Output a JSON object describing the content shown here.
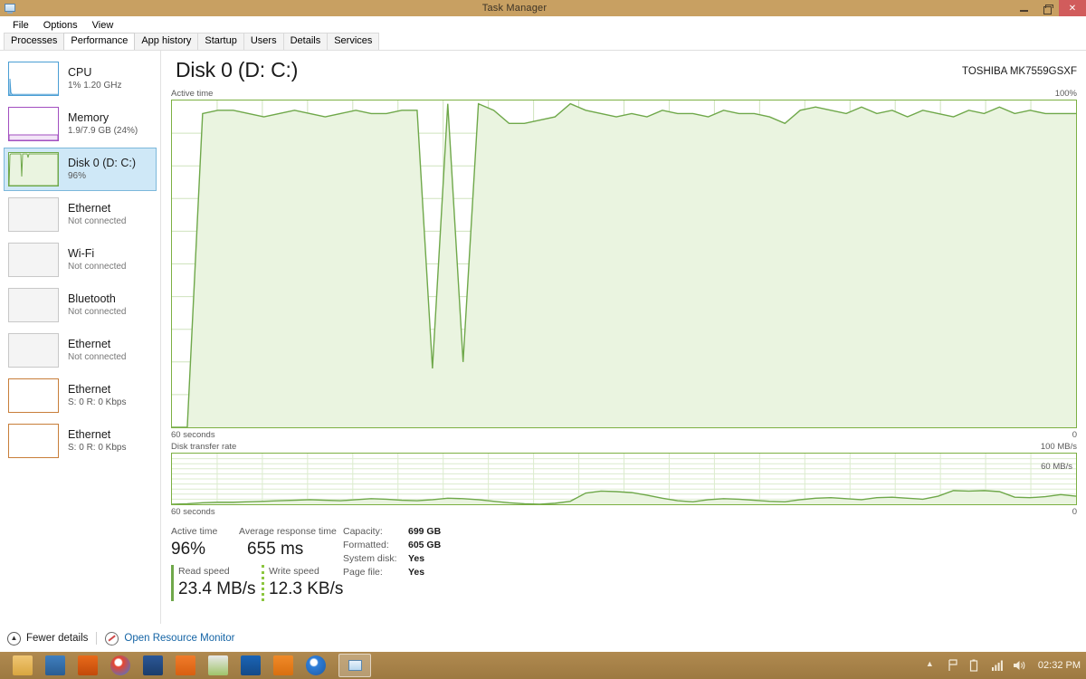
{
  "window": {
    "title": "Task Manager",
    "icon": "task-manager-icon",
    "minimize_label": "Minimize",
    "restore_label": "Restore",
    "close_label": "Close"
  },
  "menu": {
    "items": [
      "File",
      "Options",
      "View"
    ]
  },
  "tabs": {
    "items": [
      "Processes",
      "Performance",
      "App history",
      "Startup",
      "Users",
      "Details",
      "Services"
    ],
    "active": "Performance"
  },
  "sidebar": {
    "items": [
      {
        "title": "CPU",
        "sub": "1%  1.20 GHz",
        "kind": "cpu",
        "selected": false,
        "accent": "#4a9ed4"
      },
      {
        "title": "Memory",
        "sub": "1.9/7.9 GB (24%)",
        "kind": "mem",
        "selected": false,
        "accent": "#a24fc0"
      },
      {
        "title": "Disk 0 (D: C:)",
        "sub": "96%",
        "kind": "disk",
        "selected": true,
        "accent": "#6fa84a"
      },
      {
        "title": "Ethernet",
        "sub": "Not connected",
        "kind": "inactive",
        "selected": false,
        "accent": "#c8c8c8"
      },
      {
        "title": "Wi-Fi",
        "sub": "Not connected",
        "kind": "inactive",
        "selected": false,
        "accent": "#c8c8c8"
      },
      {
        "title": "Bluetooth",
        "sub": "Not connected",
        "kind": "inactive",
        "selected": false,
        "accent": "#c8c8c8"
      },
      {
        "title": "Ethernet",
        "sub": "Not connected",
        "kind": "inactive",
        "selected": false,
        "accent": "#c8c8c8"
      },
      {
        "title": "Ethernet",
        "sub": "S: 0 R: 0 Kbps",
        "kind": "eth-on",
        "selected": false,
        "accent": "#c87e3a"
      },
      {
        "title": "Ethernet",
        "sub": "S: 0 R: 0 Kbps",
        "kind": "eth-on",
        "selected": false,
        "accent": "#c87e3a"
      }
    ]
  },
  "main": {
    "title": "Disk 0 (D: C:)",
    "model": "TOSHIBA MK7559GSXF",
    "active_time_label": "Active time",
    "active_time_max": "100%",
    "active_time_min": "0",
    "time_axis_left": "60 seconds",
    "transfer_label": "Disk transfer rate",
    "transfer_max": "100 MB/s",
    "transfer_mid": "60 MB/s",
    "transfer_min": "0",
    "transfer_time_left": "60 seconds"
  },
  "stats": {
    "active_time_caption": "Active time",
    "active_time_value": "96%",
    "avg_response_caption": "Average response time",
    "avg_response_value": "655 ms",
    "read_speed_caption": "Read speed",
    "read_speed_value": "23.4 MB/s",
    "write_speed_caption": "Write speed",
    "write_speed_value": "12.3 KB/s",
    "details": [
      {
        "key": "Capacity:",
        "value": "699 GB"
      },
      {
        "key": "Formatted:",
        "value": "605 GB"
      },
      {
        "key": "System disk:",
        "value": "Yes"
      },
      {
        "key": "Page file:",
        "value": "Yes"
      }
    ]
  },
  "footer": {
    "fewer_details": "Fewer details",
    "open_resource_monitor": "Open Resource Monitor",
    "chevron_icon": "chevron-up-icon",
    "resource_monitor_icon": "resource-monitor-icon"
  },
  "taskbar": {
    "icons": [
      "file-explorer-icon",
      "contacts-icon",
      "firefox-icon",
      "chrome-icon",
      "word-icon",
      "excel-icon",
      "notepad-icon",
      "outlook-icon",
      "media-player-icon",
      "music-icon"
    ],
    "active_window_icon": "task-manager-icon",
    "tray_icons": [
      "show-hidden-icon",
      "action-center-icon",
      "battery-icon",
      "network-icon",
      "volume-icon"
    ],
    "clock": "02:32 PM"
  },
  "colors": {
    "titlebar": "#c8a062",
    "close_button": "#d15c5c",
    "graph_line": "#6fa84a",
    "graph_fill": "#eaf4e0",
    "grid": "#cfe3bd",
    "selection": "#cfe8f7",
    "link": "#1464a5",
    "taskbar": "#a88049"
  },
  "chart_data": {
    "type": "area",
    "title": "Active time",
    "xlabel": "60 seconds",
    "ylabel": "%",
    "ylim": [
      0,
      100
    ],
    "x": [
      0,
      1,
      2,
      3,
      4,
      5,
      6,
      7,
      8,
      9,
      10,
      11,
      12,
      13,
      14,
      15,
      16,
      17,
      18,
      19,
      20,
      21,
      22,
      23,
      24,
      25,
      26,
      27,
      28,
      29,
      30,
      31,
      32,
      33,
      34,
      35,
      36,
      37,
      38,
      39,
      40,
      41,
      42,
      43,
      44,
      45,
      46,
      47,
      48,
      49,
      50,
      51,
      52,
      53,
      54,
      55,
      56,
      57,
      58,
      59
    ],
    "values": [
      0,
      0,
      96,
      97,
      97,
      96,
      95,
      96,
      97,
      96,
      95,
      96,
      97,
      96,
      96,
      97,
      97,
      18,
      99,
      20,
      99,
      97,
      93,
      93,
      94,
      95,
      99,
      97,
      96,
      95,
      96,
      95,
      97,
      96,
      96,
      95,
      97,
      96,
      96,
      95,
      93,
      97,
      98,
      97,
      96,
      98,
      96,
      97,
      95,
      97,
      96,
      95,
      97,
      96,
      98,
      96,
      97,
      96,
      96,
      96
    ],
    "secondary_chart": {
      "type": "area",
      "title": "Disk transfer rate",
      "xlabel": "60 seconds",
      "ylabel": "MB/s",
      "ylim": [
        0,
        100
      ],
      "gridline_labels": [
        "100 MB/s",
        "60 MB/s",
        "0"
      ],
      "values": [
        0,
        1,
        3,
        4,
        4,
        5,
        6,
        7,
        8,
        9,
        8,
        7,
        9,
        11,
        10,
        8,
        7,
        9,
        12,
        11,
        9,
        6,
        3,
        1,
        0,
        2,
        6,
        22,
        26,
        25,
        23,
        18,
        12,
        7,
        5,
        9,
        11,
        10,
        8,
        6,
        5,
        9,
        12,
        13,
        11,
        9,
        13,
        14,
        12,
        10,
        16,
        27,
        26,
        27,
        25,
        14,
        13,
        15,
        19,
        16
      ]
    }
  }
}
